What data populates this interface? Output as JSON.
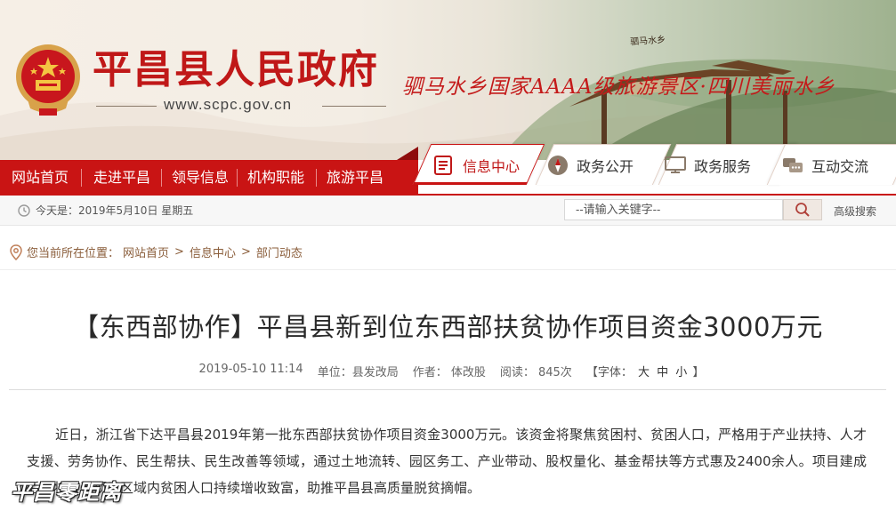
{
  "header": {
    "site_title": "平昌县人民政府",
    "site_url": "www.scpc.gov.cn",
    "slogan": "驷马水乡国家AAAA级旅游景区·四川美丽水乡",
    "gate_sign": "驷马水乡"
  },
  "nav": {
    "items": [
      "网站首页",
      "走进平昌",
      "领导信息",
      "机构职能",
      "旅游平昌"
    ],
    "tabs": [
      {
        "label": "信息中心",
        "icon": "news-icon",
        "active": true
      },
      {
        "label": "政务公开",
        "icon": "compass-icon",
        "active": false
      },
      {
        "label": "政务服务",
        "icon": "monitor-icon",
        "active": false
      },
      {
        "label": "互动交流",
        "icon": "chat-icon",
        "active": false
      }
    ]
  },
  "toolbar": {
    "date_text": "今天是：2019年5月10日  星期五",
    "search_placeholder": "--请输入关键字--",
    "advanced_search": "高级搜索"
  },
  "breadcrumb": {
    "prefix": "您当前所在位置：",
    "items": [
      "网站首页",
      "信息中心",
      "部门动态"
    ]
  },
  "article": {
    "title": "【东西部协作】平昌县新到位东西部扶贫协作项目资金3000万元",
    "date": "2019-05-10 11:14",
    "unit": "单位：县发改局",
    "author": "作者： 体改股",
    "reads": "阅读： 845次",
    "font_label": "【字体：",
    "font_sizes": [
      "大",
      "中",
      "小"
    ],
    "font_close": "】",
    "body": "近日，浙江省下达平昌县2019年第一批东西部扶贫协作项目资金3000万元。该资金将聚焦贫困村、贫困人口，严格用于产业扶持、人才支援、劳务协作、民生帮扶、民生改善等领域，通过土地流转、园区务工、产业带动、股权量化、基金帮扶等方式惠及2400余人。项目建成后，将带动项目区域内贫困人口持续增收致富，助推平昌县高质量脱贫摘帽。"
  },
  "watermark": "平昌零距离",
  "colors": {
    "brand_red": "#c91414",
    "breadcrumb_brown": "#8a5d3a"
  }
}
